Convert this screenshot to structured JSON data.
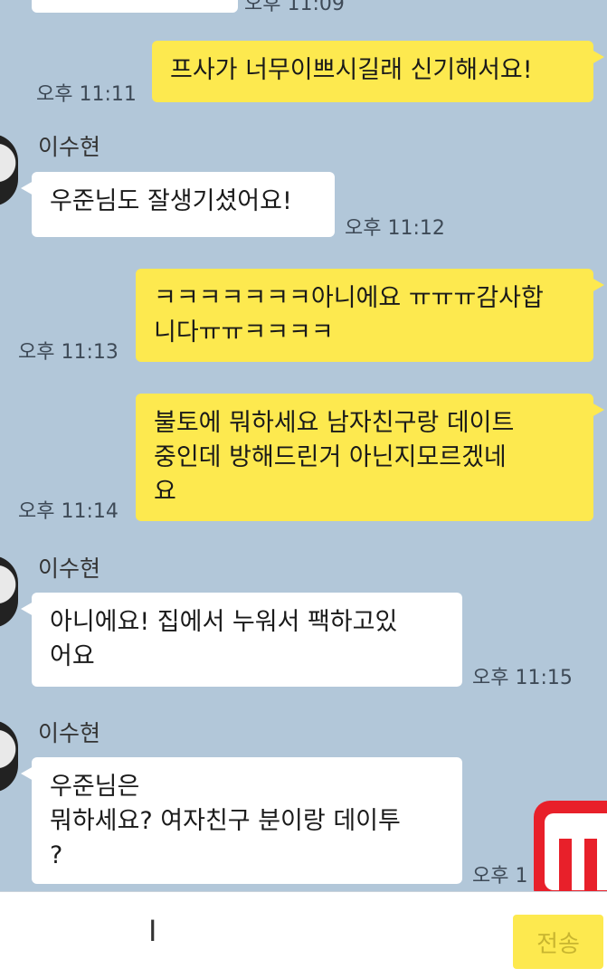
{
  "messages": [
    {
      "id": "m0",
      "side": "other",
      "text": "",
      "time": "오후 11:09"
    },
    {
      "id": "m1",
      "side": "me",
      "text": "프사가 너무이쁘시길래 신기해서요!",
      "time": "오후 11:11"
    },
    {
      "id": "m2",
      "side": "other",
      "sender": "이수현",
      "text": "우준님도 잘생기셨어요!",
      "time": "오후 11:12"
    },
    {
      "id": "m3",
      "side": "me",
      "text": "ㅋㅋㅋㅋㅋㅋㅋ아니에요 ㅠㅠㅠ감사합\n니다ㅠㅠㅋㅋㅋㅋ",
      "time": "오후 11:13"
    },
    {
      "id": "m4",
      "side": "me",
      "text": "불토에 뭐하세요 남자친구랑 데이트\n중인데 방해드린거 아닌지모르겠네\n요",
      "time": "오후 11:14"
    },
    {
      "id": "m5",
      "side": "other",
      "sender": "이수현",
      "text": "아니에요! 집에서 누워서 팩하고있\n어요",
      "time": "오후 11:15"
    },
    {
      "id": "m6",
      "side": "other",
      "sender": "이수현",
      "text": "우준님은\n뭐하세요? 여자친구 분이랑 데이투\n?",
      "time": "오후 1"
    }
  ],
  "input": {
    "placeholder": "",
    "send_label": "전송"
  },
  "colors": {
    "background": "#b2c7d9",
    "my_bubble": "#fde94f",
    "other_bubble": "#ffffff",
    "watermark": "#e8202a"
  }
}
